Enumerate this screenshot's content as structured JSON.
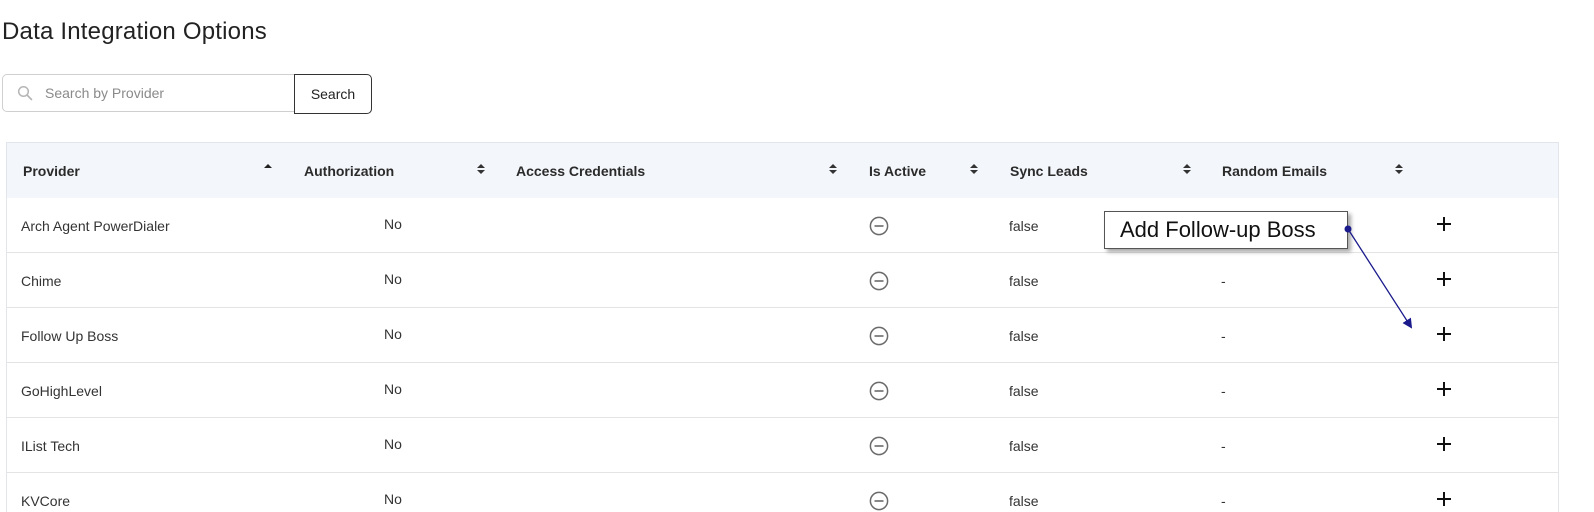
{
  "page": {
    "title": "Data Integration Options"
  },
  "search": {
    "placeholder": "Search by Provider",
    "value": "",
    "button_label": "Search"
  },
  "table": {
    "columns": [
      {
        "label": "Provider",
        "sort": "asc"
      },
      {
        "label": "Authorization",
        "sort": "none"
      },
      {
        "label": "Access Credentials",
        "sort": "none"
      },
      {
        "label": "Is Active",
        "sort": "none"
      },
      {
        "label": "Sync Leads",
        "sort": "none"
      },
      {
        "label": "Random Emails",
        "sort": "none"
      }
    ],
    "rows": [
      {
        "provider": "Arch Agent PowerDialer",
        "authorization": "No",
        "access_credentials": "",
        "is_active_icon": "minus-circle-icon",
        "sync_leads": "false",
        "random_emails": "-"
      },
      {
        "provider": "Chime",
        "authorization": "No",
        "access_credentials": "",
        "is_active_icon": "minus-circle-icon",
        "sync_leads": "false",
        "random_emails": "-"
      },
      {
        "provider": "Follow Up Boss",
        "authorization": "No",
        "access_credentials": "",
        "is_active_icon": "minus-circle-icon",
        "sync_leads": "false",
        "random_emails": "-"
      },
      {
        "provider": "GoHighLevel",
        "authorization": "No",
        "access_credentials": "",
        "is_active_icon": "minus-circle-icon",
        "sync_leads": "false",
        "random_emails": "-"
      },
      {
        "provider": "IList Tech",
        "authorization": "No",
        "access_credentials": "",
        "is_active_icon": "minus-circle-icon",
        "sync_leads": "false",
        "random_emails": "-"
      },
      {
        "provider": "KVCore",
        "authorization": "No",
        "access_credentials": "",
        "is_active_icon": "minus-circle-icon",
        "sync_leads": "false",
        "random_emails": "-"
      }
    ],
    "action_icon": "plus-icon"
  },
  "annotation": {
    "text": "Add Follow-up Boss",
    "arrow_color": "#1a1a8c"
  },
  "colors": {
    "header_bg": "#f3f6fa",
    "row_border": "#e4e4e4",
    "icon_gray": "#6b6b6b"
  }
}
